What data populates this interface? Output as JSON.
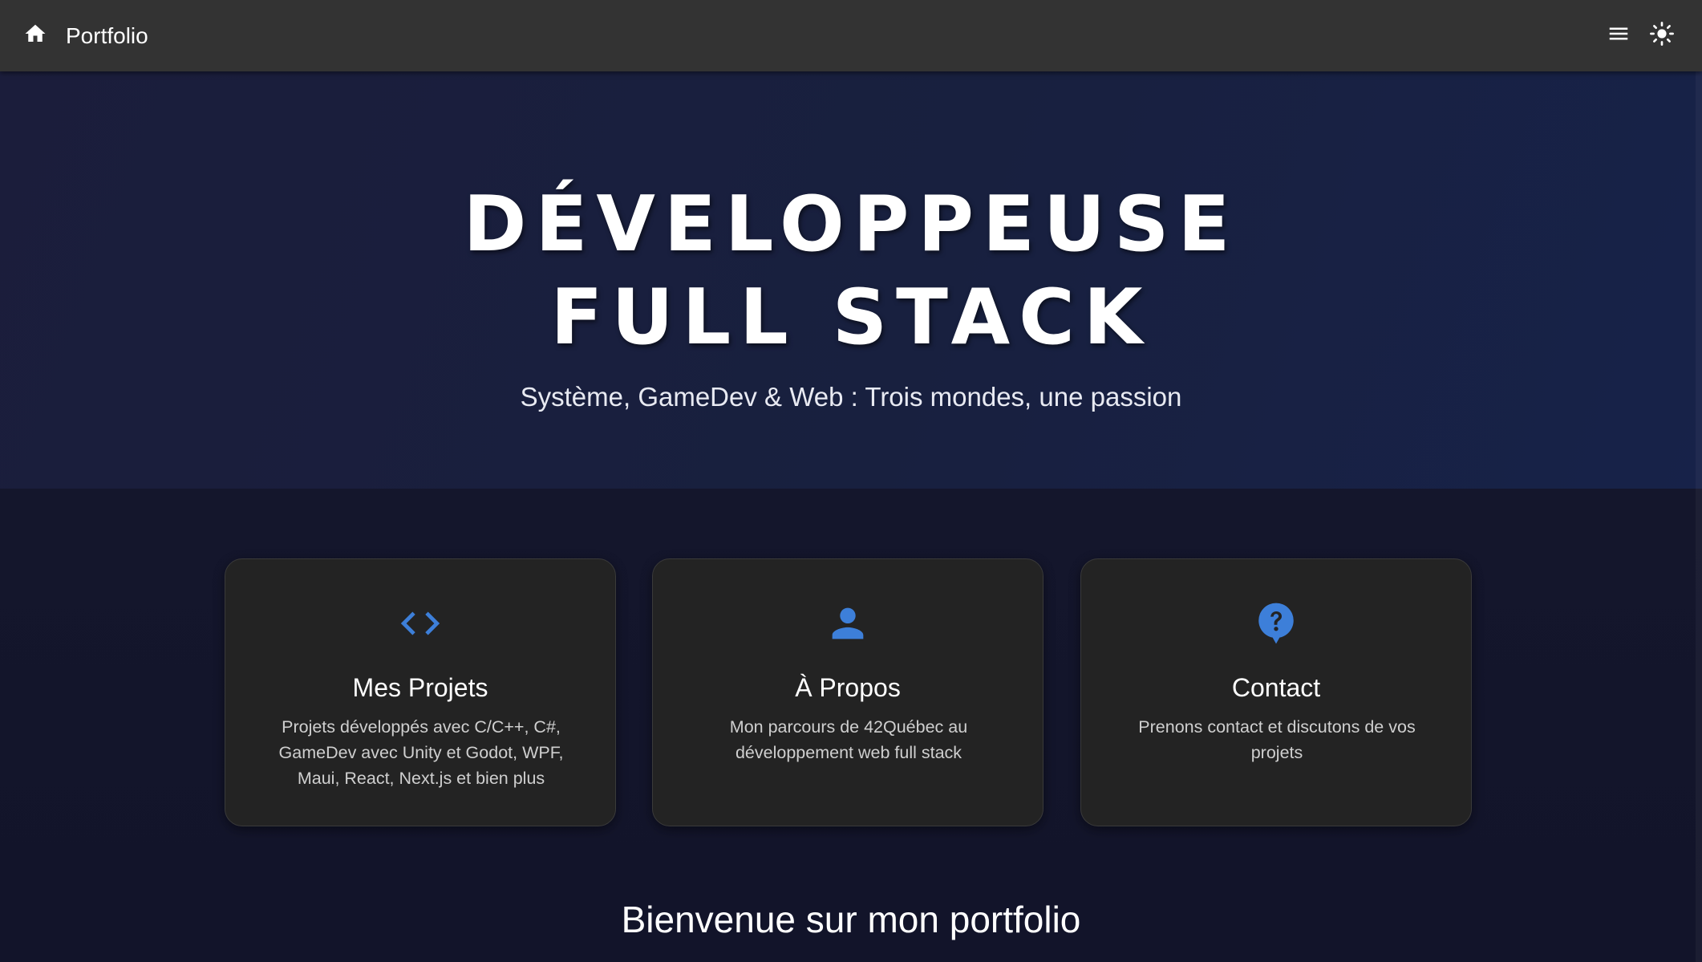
{
  "appbar": {
    "brand": "Portfolio",
    "home_icon": "home-icon",
    "menu_icon": "hamburger-menu-icon",
    "theme_icon": "sun-icon"
  },
  "hero": {
    "title_line1": "DÉVELOPPEUSE",
    "title_line2": "FULL STACK",
    "subtitle": "Système, GameDev & Web : Trois mondes, une passion"
  },
  "cards": [
    {
      "icon": "code-icon",
      "title": "Mes Projets",
      "description": "Projets développés avec C/C++, C#, GameDev avec Unity et Godot, WPF, Maui, React, Next.js et bien plus"
    },
    {
      "icon": "person-icon",
      "title": "À Propos",
      "description": "Mon parcours de 42Québec au développement web full stack"
    },
    {
      "icon": "help-bubble-icon",
      "title": "Contact",
      "description": "Prenons contact et discutons de vos projets"
    }
  ],
  "welcome": "Bienvenue sur mon portfolio",
  "colors": {
    "appbar": "#333333",
    "accent": "#3d7fd9",
    "card_bg": "#232323",
    "page_bg": "#13152b"
  }
}
